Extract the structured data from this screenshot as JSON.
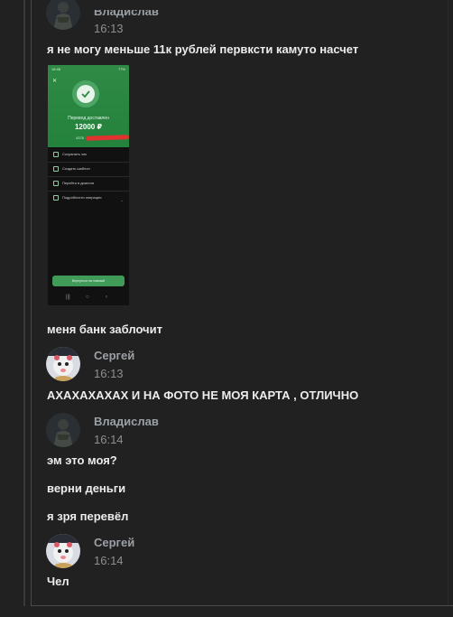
{
  "top_message": {
    "name": "Владислав",
    "time": "16:13",
    "text": "я не могу меньше 11к рублей первксти камуто насчет"
  },
  "screenshot_attachment": {
    "status_left": "16:46",
    "status_right": "77%",
    "close_glyph": "✕",
    "title": "Перевод доставлен",
    "amount": "12000 ₽",
    "card_mask": "4378",
    "rows": [
      "Сохранить чек",
      "Создать шаблон",
      "Перейти в диалоги",
      "Подробности операции"
    ],
    "button_label": "Вернуться на главный",
    "nav": [
      "|||",
      "○",
      "‹"
    ],
    "accent_color": "#2f8a45",
    "redaction_color": "#e2322f"
  },
  "caption": "меня банк заблочит",
  "messages": [
    {
      "author": "Сергей",
      "time": "16:13",
      "lines": [
        "АХАХАХАХАХ И НА ФОТО НЕ МОЯ КАРТА , ОТЛИЧНО"
      ]
    },
    {
      "author": "Владислав",
      "time": "16:14",
      "lines": [
        "эм это моя?",
        "верни деньги",
        "я зря перевёл"
      ]
    },
    {
      "author": "Сергей",
      "time": "16:14",
      "lines": [
        "Чел"
      ]
    }
  ]
}
